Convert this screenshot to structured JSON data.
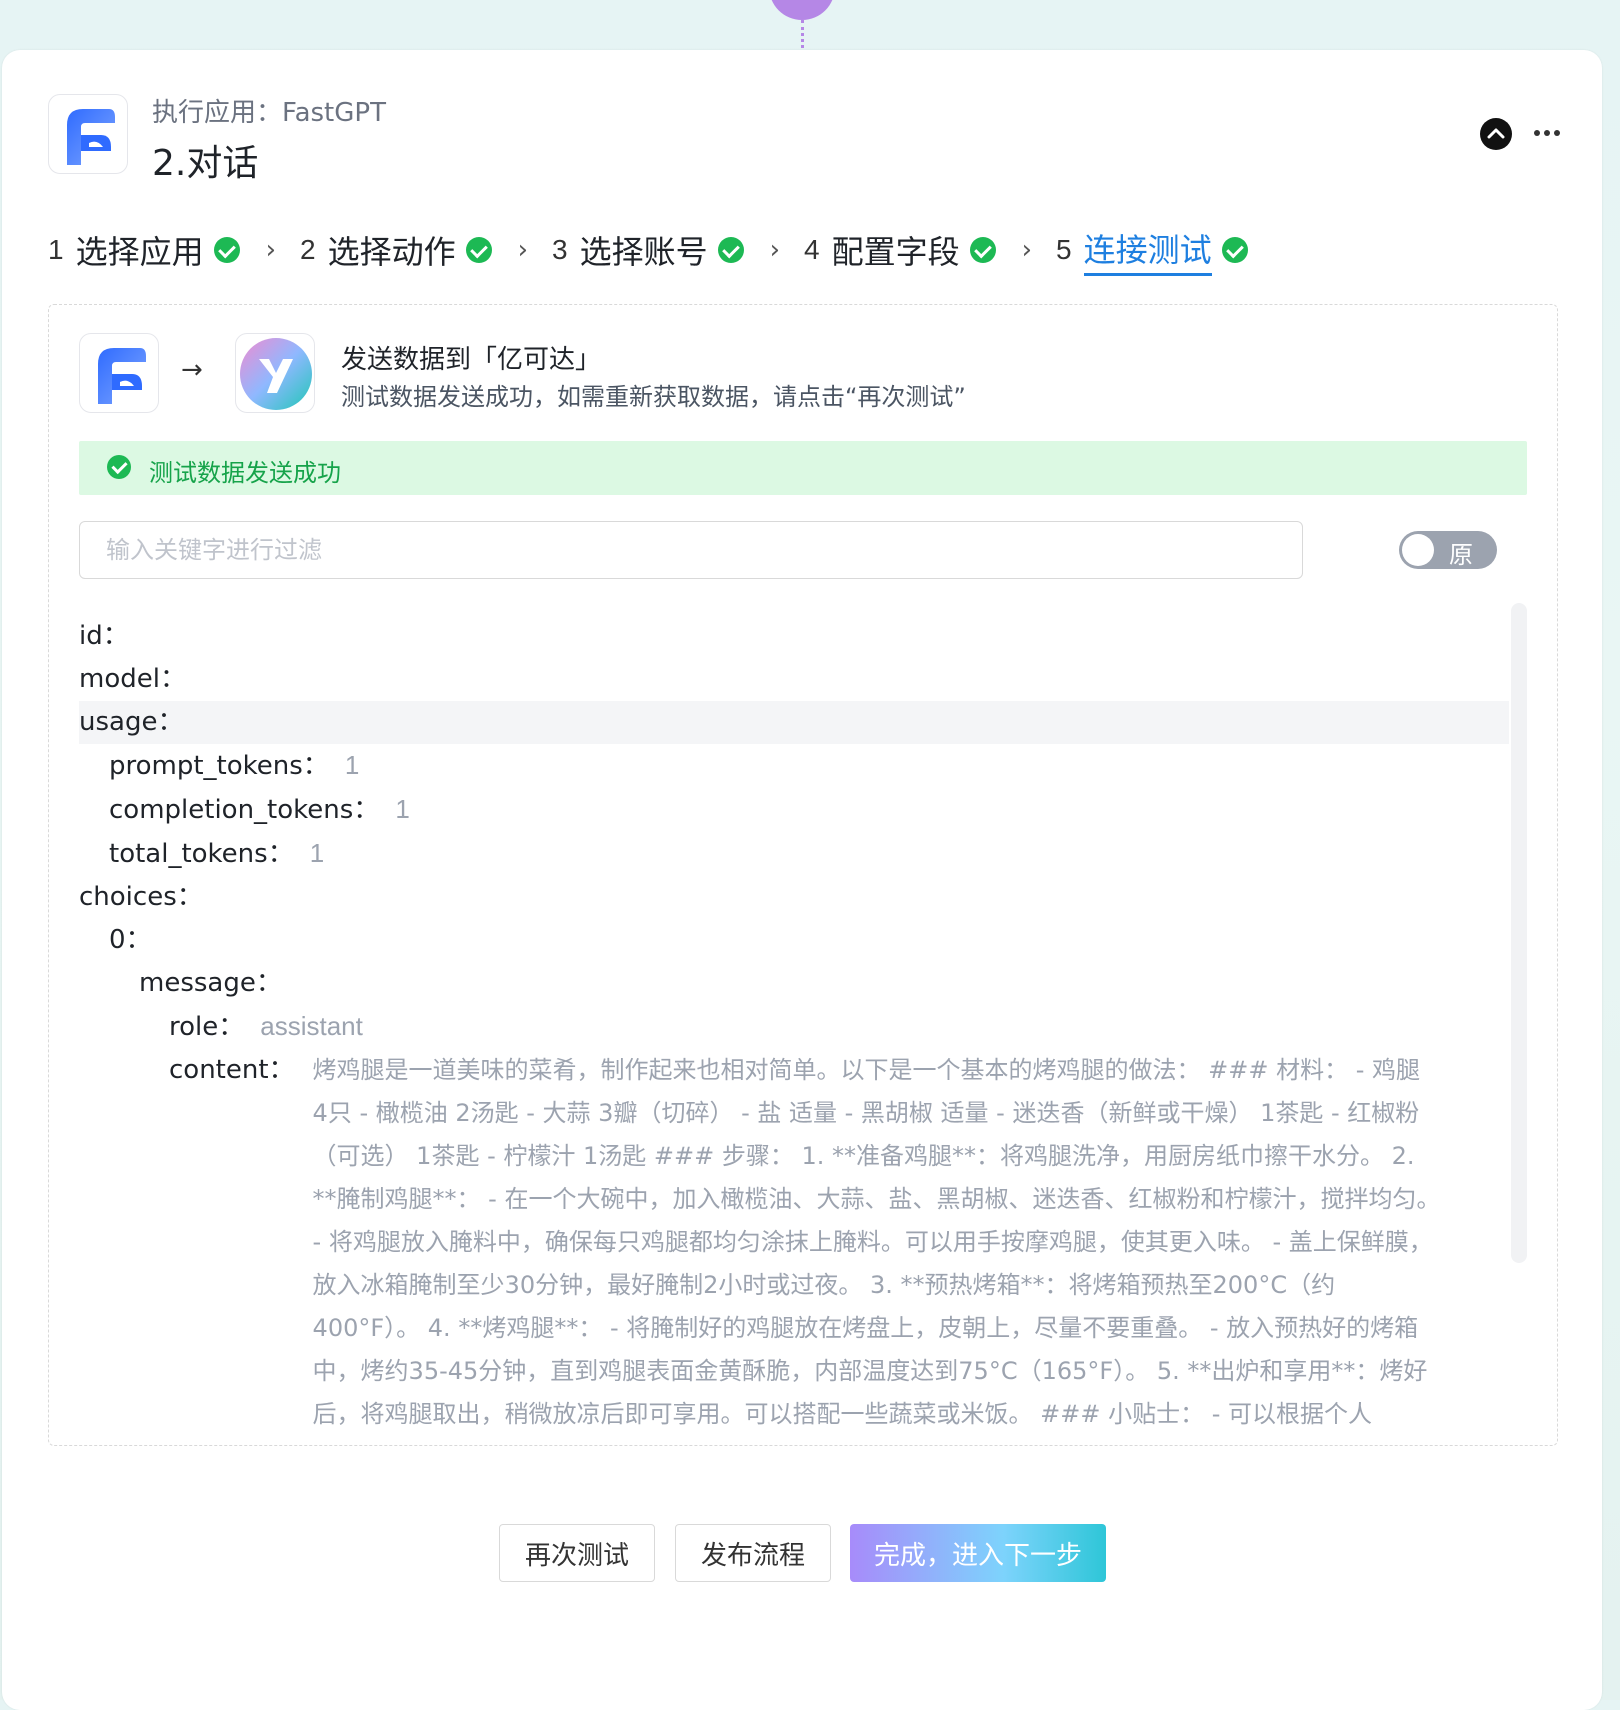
{
  "header": {
    "subtitle": "执行应用：FastGPT",
    "title": "2.对话"
  },
  "icons": {
    "collapse": "chevron-up-circle-icon",
    "more": "more-horizontal-icon",
    "check": "check-circle-icon",
    "arrow": "arrow-right-icon"
  },
  "steps": [
    {
      "num": "1",
      "label": "选择应用"
    },
    {
      "num": "2",
      "label": "选择动作"
    },
    {
      "num": "3",
      "label": "选择账号"
    },
    {
      "num": "4",
      "label": "配置字段"
    },
    {
      "num": "5",
      "label": "连接测试"
    }
  ],
  "test": {
    "arrow": "→",
    "title": "发送数据到「亿可达」",
    "description": "测试数据发送成功，如需重新获取数据，请点击“再次测试”",
    "success": "测试数据发送成功",
    "filter_placeholder": "输入关键字进行过滤",
    "toggle_label": "原"
  },
  "tree": {
    "id_key": "id：",
    "model_key": "model：",
    "usage_key": "usage：",
    "prompt_tokens_key": "prompt_tokens：",
    "prompt_tokens_val": "1",
    "completion_tokens_key": "completion_tokens：",
    "completion_tokens_val": "1",
    "total_tokens_key": "total_tokens：",
    "total_tokens_val": "1",
    "choices_key": "choices：",
    "index_key": "0：",
    "message_key": "message：",
    "role_key": "role：",
    "role_val": "assistant",
    "content_key": "content：",
    "content_val": "烤鸡腿是一道美味的菜肴，制作起来也相对简单。以下是一个基本的烤鸡腿的做法： ### 材料： - 鸡腿 4只 - 橄榄油 2汤匙 - 大蒜 3瓣（切碎） - 盐 适量 - 黑胡椒 适量 - 迷迭香（新鲜或干燥） 1茶匙 - 红椒粉（可选） 1茶匙 - 柠檬汁 1汤匙 ### 步骤： 1. **准备鸡腿**：将鸡腿洗净，用厨房纸巾擦干水分。 2. **腌制鸡腿**： - 在一个大碗中，加入橄榄油、大蒜、盐、黑胡椒、迷迭香、红椒粉和柠檬汁，搅拌均匀。 - 将鸡腿放入腌料中，确保每只鸡腿都均匀涂抹上腌料。可以用手按摩鸡腿，使其更入味。 - 盖上保鲜膜，放入冰箱腌制至少30分钟，最好腌制2小时或过夜。 3. **预热烤箱**：将烤箱预热至200°C（约400°F）。 4. **烤鸡腿**： - 将腌制好的鸡腿放在烤盘上，皮朝上，尽量不要重叠。 - 放入预热好的烤箱中，烤约35-45分钟，直到鸡腿表面金黄酥脆，内部温度达到75°C（165°F）。 5. **出炉和享用**：烤好后，将鸡腿取出，稍微放凉后即可享用。可以搭配一些蔬菜或米饭。 ### 小贴士： - 可以根据个人"
  },
  "buttons": {
    "retest": "再次测试",
    "publish": "发布流程",
    "finish": "完成，进入下一步"
  },
  "colors": {
    "accent": "#1e7fe0",
    "success": "#1db954",
    "success_bg": "#dcf9e3",
    "primary_gradient_start": "#a78bfa",
    "primary_gradient_end": "#2ec6d8"
  }
}
